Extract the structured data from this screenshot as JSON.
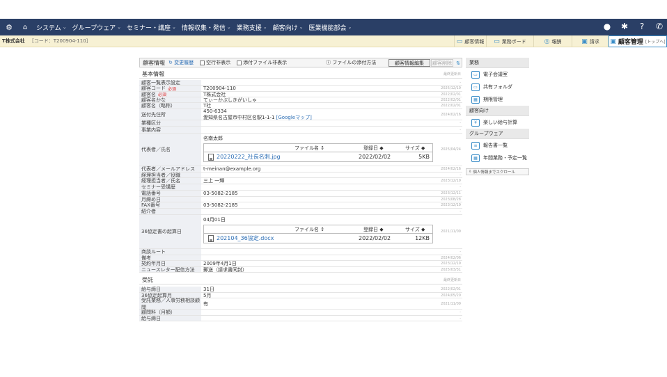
{
  "nav": {
    "items": [
      {
        "label": "システム"
      },
      {
        "label": "グループウェア"
      },
      {
        "label": "セミナー・講座"
      },
      {
        "label": "情報収集・発信"
      },
      {
        "label": "業務支援"
      },
      {
        "label": "顧客向け"
      },
      {
        "label": "医業機能部会"
      }
    ]
  },
  "subhead": {
    "company": "T株式会社",
    "code": "［コード：T200904-110］",
    "tabs": [
      {
        "label": "顧客情報",
        "icon": "customer-info-icon"
      },
      {
        "label": "業務ボード",
        "icon": "board-icon"
      },
      {
        "label": "報酬",
        "icon": "fee-icon"
      },
      {
        "label": "請求",
        "icon": "invoice-icon"
      }
    ],
    "active_tab": {
      "label": "顧客管理",
      "suffix": "[トップへ]"
    }
  },
  "toolbar": {
    "title": "顧客情報",
    "history": "変更履歴",
    "chk_blank": "空行非表示",
    "chk_attach": "添付ファイル非表示",
    "attach_howto": "ファイルの添付方法",
    "edit": "顧客情報編集",
    "delete": "顧客削除"
  },
  "sections": {
    "basic": "基本情報",
    "basic_right": "最終更新日",
    "contract": "受託",
    "contract_right": "最終更新日"
  },
  "rows": [
    {
      "label": "顧客一覧表示設定",
      "value": "",
      "date": "-"
    },
    {
      "label": "顧客コード",
      "req": "必須",
      "value": "T200904-110",
      "date": "2025/12/19"
    },
    {
      "label": "顧客名",
      "req": "必須",
      "value": "T株式会社",
      "date": "2022/02/01"
    },
    {
      "label": "顧客名かな",
      "value": "てぃーかぶしきがいしゃ",
      "date": "2022/02/01"
    },
    {
      "label": "顧客名（略称）",
      "value": "T社",
      "date": "2022/02/01"
    },
    {
      "label": "送付先住所",
      "value": "450-6334",
      "value2": "愛知県名古屋市中村区名駅1-1-1",
      "link": "[Googleマップ]",
      "date": "2024/02/16"
    },
    {
      "label": "業種区分",
      "value": "",
      "date": "-"
    },
    {
      "label": "事業内容",
      "value": "",
      "date": "-"
    },
    {
      "label": "代表者／氏名",
      "value": "名南太郎",
      "date": "2025/04/24"
    },
    {
      "label": "代表者／メールアドレス",
      "value": "t-meinan@example.org",
      "date": "2024/02/16"
    },
    {
      "label": "経理担当者／役職",
      "value": "",
      "date": "-"
    },
    {
      "label": "経理担当者／氏名",
      "value": "三上 一輝",
      "date": "2023/12/19"
    },
    {
      "label": "セミナー受講歴",
      "value": "",
      "date": "-"
    },
    {
      "label": "電話番号",
      "value": "03-5082-2185",
      "date": "2023/12/11"
    },
    {
      "label": "月締め日",
      "value": "",
      "date": "2023/08/28"
    },
    {
      "label": "FAX番号",
      "value": "03-5082-2185",
      "date": "2023/12/19"
    },
    {
      "label": "紹介者",
      "value": "",
      "date": "-"
    },
    {
      "label": "36協定書の起算日",
      "value": "04月01日",
      "date": "2021/11/09"
    },
    {
      "label": "商談ルート",
      "value": "",
      "date": "-"
    },
    {
      "label": "備考",
      "value": "",
      "date": "2024/02/06"
    },
    {
      "label": "契約年月日",
      "value": "2009年4月1日",
      "date": "2023/12/19"
    },
    {
      "label": "ニュースレター配信方法",
      "value": "郵送（請求書同封）",
      "date": "2025/03/31"
    },
    {
      "label": "給与締日",
      "value": "31日",
      "date": "2022/02/01"
    },
    {
      "label": "36協定起算月",
      "value": "5月",
      "date": "2024/05/20"
    },
    {
      "label": "受託業務／人事労務相談顧問",
      "value": "有",
      "date": "2021/11/09"
    },
    {
      "label": "顧問料（月額）",
      "value": "",
      "date": "-"
    },
    {
      "label": "給与締日",
      "value": "",
      "date": "-"
    }
  ],
  "files": {
    "col_name": "ファイル名",
    "col_date": "登録日",
    "col_size": "サイズ",
    "rep": {
      "name": "20220222_社長名刺.jpg",
      "date": "2022/02/02",
      "size": "5KB"
    },
    "kyotei": {
      "name": "202104_36協定.docx",
      "date": "2022/02/02",
      "size": "12KB"
    }
  },
  "sidebar": {
    "sections": [
      {
        "head": "業務",
        "items": [
          "電子会議室",
          "共有フォルダ",
          "期限管理"
        ]
      },
      {
        "head": "顧客向け",
        "items": [
          "楽しい給与計算"
        ]
      },
      {
        "head": "グループウェア",
        "items": [
          "報告書一覧",
          "年間業務・予定一覧"
        ]
      }
    ],
    "scroll": "個人情報までスクロール"
  }
}
